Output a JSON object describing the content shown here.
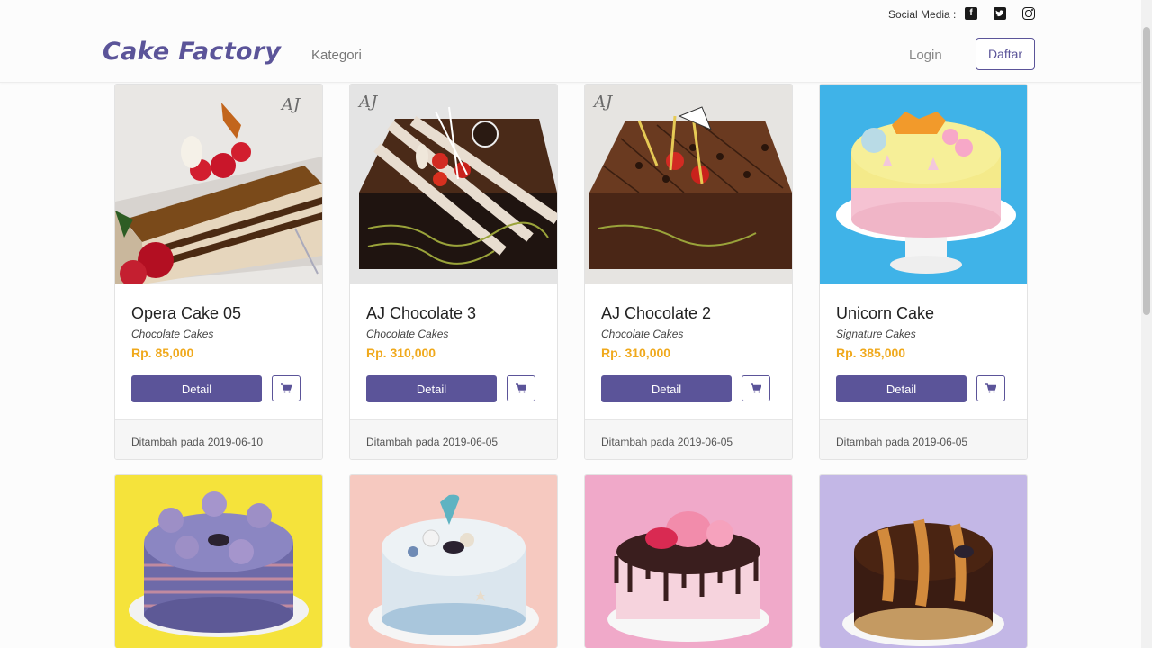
{
  "social": {
    "label": "Social Media :",
    "icons": [
      "facebook-icon",
      "twitter-icon",
      "instagram-icon"
    ]
  },
  "nav": {
    "brand": "Cake Factory",
    "kategori": "Kategori",
    "login": "Login",
    "daftar": "Daftar"
  },
  "colors": {
    "accent": "#5b5499",
    "price": "#f0a91c"
  },
  "products": [
    {
      "name": "Opera Cake 05",
      "category": "Chocolate Cakes",
      "price": "Rp. 85,000",
      "detail_label": "Detail",
      "added": "Ditambah pada 2019-06-10"
    },
    {
      "name": "AJ Chocolate 3",
      "category": "Chocolate Cakes",
      "price": "Rp. 310,000",
      "detail_label": "Detail",
      "added": "Ditambah pada 2019-06-05"
    },
    {
      "name": "AJ Chocolate 2",
      "category": "Chocolate Cakes",
      "price": "Rp. 310,000",
      "detail_label": "Detail",
      "added": "Ditambah pada 2019-06-05"
    },
    {
      "name": "Unicorn Cake",
      "category": "Signature Cakes",
      "price": "Rp. 385,000",
      "detail_label": "Detail",
      "added": "Ditambah pada 2019-06-05"
    }
  ]
}
